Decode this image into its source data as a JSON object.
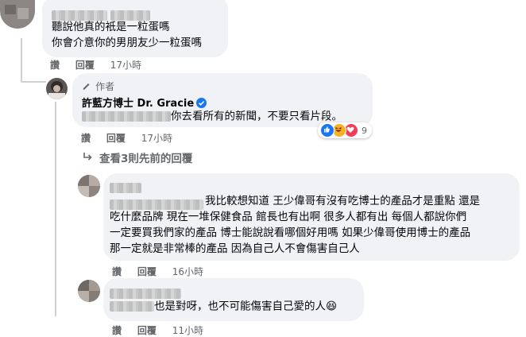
{
  "comment1": {
    "lines": [
      "聽說他真的衹是一粒蛋嗎",
      "你會介意你的男朋友少一粒蛋嗎"
    ],
    "actions": {
      "like": "讚",
      "reply": "回覆",
      "time": "17小時"
    }
  },
  "reply1": {
    "author_tag": "作者",
    "author_name": "許藍方博士 Dr. Gracie",
    "text": "你去看所有的新聞，不要只看片段。",
    "reactions": {
      "icons": [
        "like-icon",
        "haha-icon",
        "love-icon"
      ],
      "count": "9"
    },
    "actions": {
      "like": "讚",
      "reply": "回覆",
      "time": "17小時"
    }
  },
  "more_replies": {
    "label": "查看3則先前的回覆"
  },
  "reply2": {
    "lines": [
      "我比較想知道 王少偉哥有沒有吃博士的產品才是重點 還是",
      "吃什麼品牌 現在一堆保健食品 館長也有出啊 很多人都有出 每個人都說你們",
      "一定要買我們家的產品 博士能說說看哪個好用嗎 如果少偉哥使用博士的產品",
      "那一定就是非常棒的產品 因為自己人不會傷害自己人"
    ],
    "actions": {
      "like": "讚",
      "reply": "回覆",
      "time": "16小時"
    }
  },
  "reply3": {
    "text": "也是對呀，也不可能傷害自己愛的人",
    "emoji": "😆",
    "actions": {
      "like": "讚",
      "reply": "回覆",
      "time": "11小時"
    }
  },
  "colors": {
    "bubble": "#f0f2f5",
    "verified": "#1877f2",
    "meta": "#65676b",
    "like": "#1877f2",
    "haha": "#f7b125",
    "love": "#f33e58"
  }
}
